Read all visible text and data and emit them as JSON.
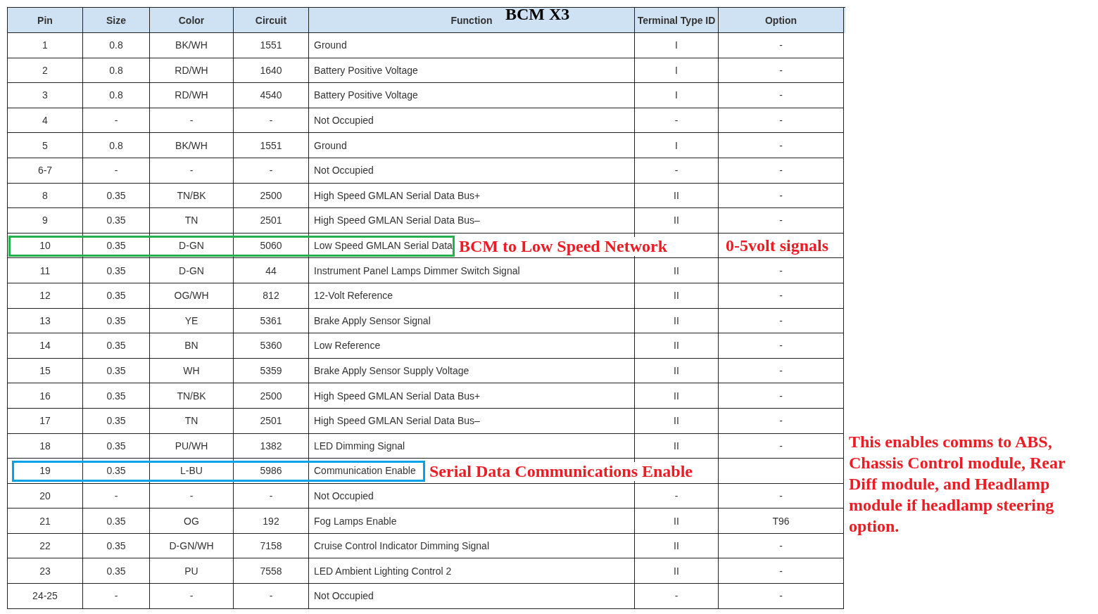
{
  "title": "BCM X3",
  "columns": [
    "Pin",
    "Size",
    "Color",
    "Circuit",
    "Function",
    "Terminal Type ID",
    "Option"
  ],
  "rows": [
    {
      "pin": "1",
      "size": "0.8",
      "wire_color": "BK/WH",
      "circuit": "1551",
      "function": "Ground",
      "terminal_type_id": "I",
      "option": "-"
    },
    {
      "pin": "2",
      "size": "0.8",
      "wire_color": "RD/WH",
      "circuit": "1640",
      "function": "Battery Positive Voltage",
      "terminal_type_id": "I",
      "option": "-"
    },
    {
      "pin": "3",
      "size": "0.8",
      "wire_color": "RD/WH",
      "circuit": "4540",
      "function": "Battery Positive Voltage",
      "terminal_type_id": "I",
      "option": "-"
    },
    {
      "pin": "4",
      "size": "-",
      "wire_color": "-",
      "circuit": "-",
      "function": "Not Occupied",
      "terminal_type_id": "-",
      "option": "-"
    },
    {
      "pin": "5",
      "size": "0.8",
      "wire_color": "BK/WH",
      "circuit": "1551",
      "function": "Ground",
      "terminal_type_id": "I",
      "option": "-"
    },
    {
      "pin": "6-7",
      "size": "-",
      "wire_color": "-",
      "circuit": "-",
      "function": "Not Occupied",
      "terminal_type_id": "-",
      "option": "-"
    },
    {
      "pin": "8",
      "size": "0.35",
      "wire_color": "TN/BK",
      "circuit": "2500",
      "function": "High Speed GMLAN Serial Data Bus+",
      "terminal_type_id": "II",
      "option": "-"
    },
    {
      "pin": "9",
      "size": "0.35",
      "wire_color": "TN",
      "circuit": "2501",
      "function": "High Speed GMLAN Serial Data Bus–",
      "terminal_type_id": "II",
      "option": "-"
    },
    {
      "pin": "10",
      "size": "0.35",
      "wire_color": "D-GN",
      "circuit": "5060",
      "function": "Low Speed GMLAN Serial Data",
      "highlight": {
        "color": "#22b14c",
        "note": "BCM to Low Speed Network"
      },
      "option_note": "0-5volt signals"
    },
    {
      "pin": "11",
      "size": "0.35",
      "wire_color": "D-GN",
      "circuit": "44",
      "function": "Instrument Panel Lamps Dimmer Switch Signal",
      "terminal_type_id": "II",
      "option": "-"
    },
    {
      "pin": "12",
      "size": "0.35",
      "wire_color": "OG/WH",
      "circuit": "812",
      "function": "12-Volt Reference",
      "terminal_type_id": "II",
      "option": "-"
    },
    {
      "pin": "13",
      "size": "0.35",
      "wire_color": "YE",
      "circuit": "5361",
      "function": "Brake Apply Sensor Signal",
      "terminal_type_id": "II",
      "option": "-"
    },
    {
      "pin": "14",
      "size": "0.35",
      "wire_color": "BN",
      "circuit": "5360",
      "function": "Low Reference",
      "terminal_type_id": "II",
      "option": "-"
    },
    {
      "pin": "15",
      "size": "0.35",
      "wire_color": "WH",
      "circuit": "5359",
      "function": "Brake Apply Sensor Supply Voltage",
      "terminal_type_id": "II",
      "option": "-"
    },
    {
      "pin": "16",
      "size": "0.35",
      "wire_color": "TN/BK",
      "circuit": "2500",
      "function": "High Speed GMLAN Serial Data Bus+",
      "terminal_type_id": "II",
      "option": "-"
    },
    {
      "pin": "17",
      "size": "0.35",
      "wire_color": "TN",
      "circuit": "2501",
      "function": "High Speed GMLAN Serial Data Bus–",
      "terminal_type_id": "II",
      "option": "-"
    },
    {
      "pin": "18",
      "size": "0.35",
      "wire_color": "PU/WH",
      "circuit": "1382",
      "function": "LED Dimming Signal",
      "terminal_type_id": "II",
      "option": "-"
    },
    {
      "pin": "19",
      "size": "0.35",
      "wire_color": "L-BU",
      "circuit": "5986",
      "function": "Communication Enable",
      "highlight": {
        "color": "#00a2e8",
        "note": "Serial Data Communications Enable"
      }
    },
    {
      "pin": "20",
      "size": "-",
      "wire_color": "-",
      "circuit": "-",
      "function": "Not Occupied",
      "terminal_type_id": "-",
      "option": "-"
    },
    {
      "pin": "21",
      "size": "0.35",
      "wire_color": "OG",
      "circuit": "192",
      "function": "Fog Lamps Enable",
      "terminal_type_id": "II",
      "option": "T96"
    },
    {
      "pin": "22",
      "size": "0.35",
      "wire_color": "D-GN/WH",
      "circuit": "7158",
      "function": "Cruise Control Indicator Dimming Signal",
      "terminal_type_id": "II",
      "option": "-"
    },
    {
      "pin": "23",
      "size": "0.35",
      "wire_color": "PU",
      "circuit": "7558",
      "function": "LED Ambient Lighting Control 2",
      "terminal_type_id": "II",
      "option": "-"
    },
    {
      "pin": "24-25",
      "size": "-",
      "wire_color": "-",
      "circuit": "-",
      "function": "Not Occupied",
      "terminal_type_id": "-",
      "option": "-"
    }
  ],
  "side_note": "This enables comms to ABS, Chassis Control module, Rear Diff module, and Headlamp module if headlamp steering option."
}
